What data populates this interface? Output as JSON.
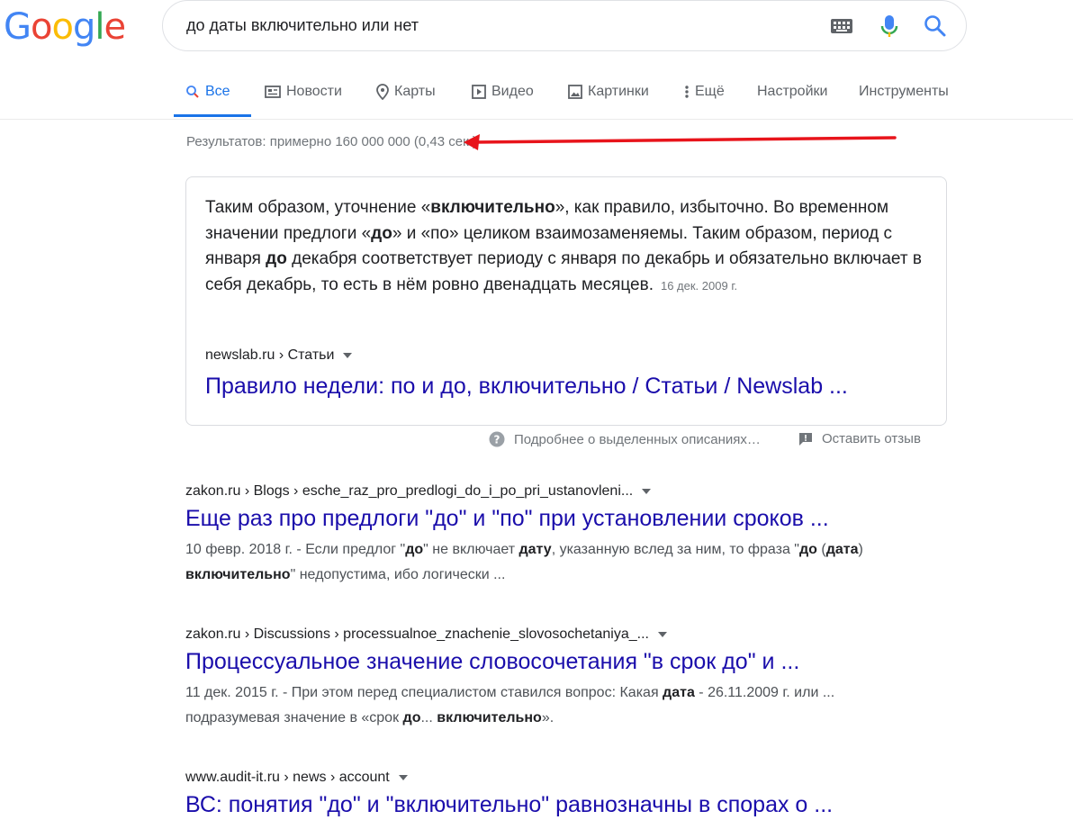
{
  "logo": {
    "letters": [
      "G",
      "o",
      "o",
      "g",
      "l",
      "e"
    ],
    "colors": [
      "#4285f4",
      "#ea4335",
      "#fbbc05",
      "#4285f4",
      "#34a853",
      "#ea4335"
    ]
  },
  "search": {
    "query": "до даты включительно или нет"
  },
  "tabs": [
    {
      "label": "Все",
      "icon": "search-icon"
    },
    {
      "label": "Новости",
      "icon": "news-icon"
    },
    {
      "label": "Карты",
      "icon": "map-pin-icon"
    },
    {
      "label": "Видео",
      "icon": "video-icon"
    },
    {
      "label": "Картинки",
      "icon": "image-icon"
    },
    {
      "label": "Ещё",
      "icon": "more-vert-icon"
    },
    {
      "label": "Настройки"
    },
    {
      "label": "Инструменты"
    }
  ],
  "stats": "Результатов: примерно 160 000 000 (0,43 сек.)",
  "featured": {
    "parts": [
      "Таким образом, уточнение «",
      "включительно",
      "», как правило, избыточно. Во временном значении предлоги «",
      "до",
      "» и «по» целиком взаимозаменяемы. Таким образом, период с января ",
      "до",
      " декабря соответствует периоду с января по декабрь и обязательно включает в себя декабрь, то есть в нём ровно двенадцать месяцев."
    ],
    "date": "16 дек. 2009 г.",
    "cite": "newslab.ru › Статьи",
    "title": "Правило недели: по и до, включительно / Статьи / Newslab ...",
    "about": "Подробнее о выделенных описаниях…",
    "feedback": "Оставить отзыв"
  },
  "results": [
    {
      "cite": "zakon.ru › Blogs › esche_raz_pro_predlogi_do_i_po_pri_ustanovleni...",
      "title": "Еще раз про предлоги \"до\" и \"по\" при установлении сроков ...",
      "date": "10 февр. 2018 г.",
      "desc": [
        {
          "t": " - Если предлог \"",
          "b": false
        },
        {
          "t": "до",
          "b": true
        },
        {
          "t": "\" не включает ",
          "b": false
        },
        {
          "t": "дату",
          "b": true
        },
        {
          "t": ", указанную вслед за ним, то фраза \"",
          "b": false
        },
        {
          "t": "до",
          "b": true
        },
        {
          "t": " (",
          "b": false
        },
        {
          "t": "дата",
          "b": true
        },
        {
          "t": ") ",
          "b": false
        },
        {
          "t": "включительно",
          "b": true
        },
        {
          "t": "\" недопустима, ибо логически ...",
          "b": false
        }
      ]
    },
    {
      "cite": "zakon.ru › Discussions › processualnoe_znachenie_slovosochetaniya_...",
      "title": "Процессуальное значение словосочетания \"в срок до\" и ...",
      "date": "11 дек. 2015 г.",
      "desc": [
        {
          "t": " - При этом перед специалистом ставился вопрос: Какая ",
          "b": false
        },
        {
          "t": "дата",
          "b": true
        },
        {
          "t": " - 26.11.2009 г. или ... подразумевая значение в «срок ",
          "b": false
        },
        {
          "t": "до",
          "b": true
        },
        {
          "t": "... ",
          "b": false
        },
        {
          "t": "включительно",
          "b": true
        },
        {
          "t": "».",
          "b": false
        }
      ]
    },
    {
      "cite": "www.audit-it.ru › news › account",
      "title": "ВС: понятия \"до\" и \"включительно\" равнозначны в спорах о ...",
      "date": "",
      "desc": []
    }
  ]
}
